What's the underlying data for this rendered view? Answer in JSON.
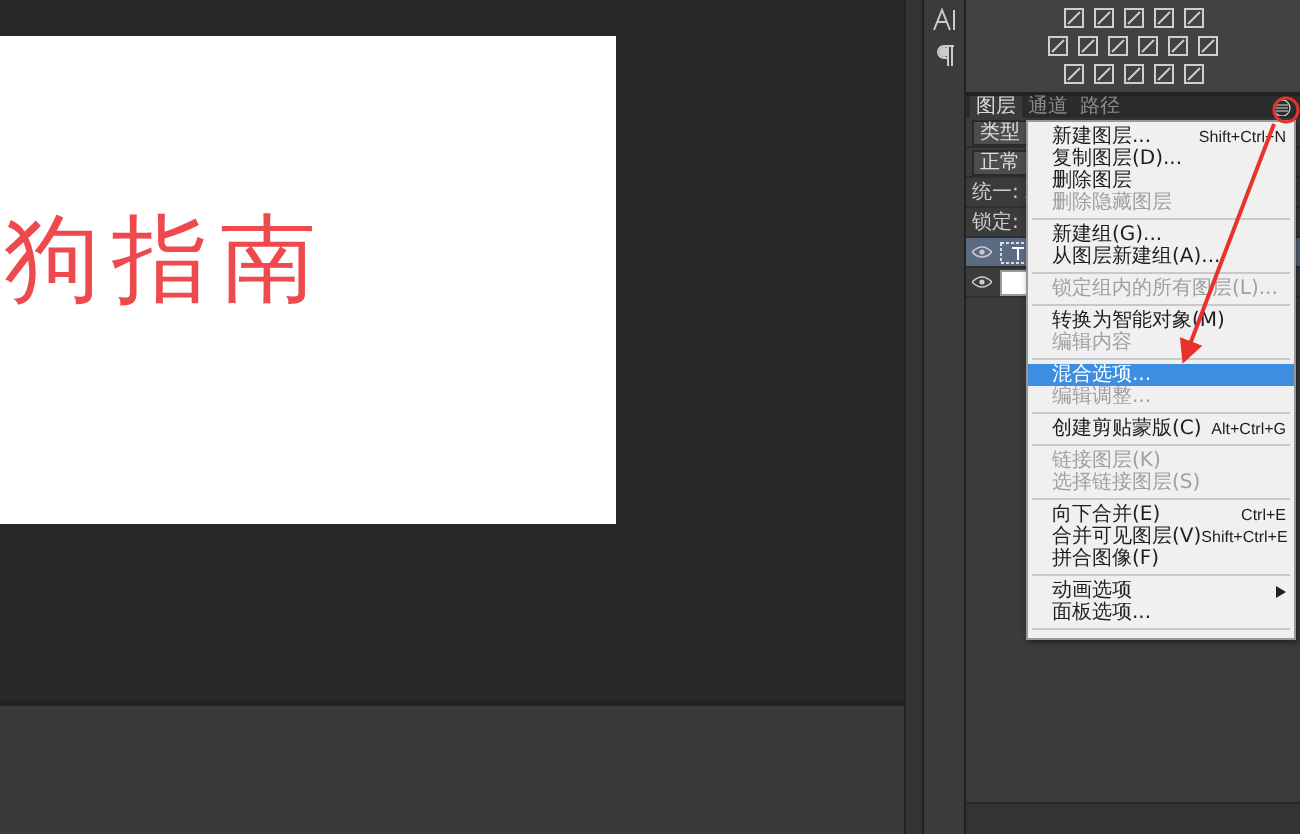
{
  "canvas": {
    "text": "狗指南"
  },
  "layers_panel": {
    "tabs": [
      {
        "label": "图层",
        "selected": true
      },
      {
        "label": "通道",
        "selected": false
      },
      {
        "label": "路径",
        "selected": false
      }
    ],
    "filter": "类型",
    "blend_mode": "正常",
    "unify_label": "统一:",
    "lock_label": "锁定:",
    "layers": [
      {
        "kind": "text",
        "visible": true,
        "selected": true
      },
      {
        "kind": "fill",
        "visible": true,
        "selected": false
      }
    ]
  },
  "context_menu": {
    "items": [
      {
        "kind": "item",
        "label": "新建图层...",
        "shortcut": "Shift+Ctrl+N",
        "disabled": false,
        "selected": false
      },
      {
        "kind": "item",
        "label": "复制图层(D)...",
        "disabled": false,
        "selected": false
      },
      {
        "kind": "item",
        "label": "删除图层",
        "disabled": false,
        "selected": false
      },
      {
        "kind": "item",
        "label": "删除隐藏图层",
        "disabled": true,
        "selected": false
      },
      {
        "kind": "separator"
      },
      {
        "kind": "item",
        "label": "新建组(G)...",
        "disabled": false,
        "selected": false
      },
      {
        "kind": "item",
        "label": "从图层新建组(A)...",
        "disabled": false,
        "selected": false
      },
      {
        "kind": "separator"
      },
      {
        "kind": "item",
        "label": "锁定组内的所有图层(L)...",
        "disabled": true,
        "selected": false
      },
      {
        "kind": "separator"
      },
      {
        "kind": "item",
        "label": "转换为智能对象(M)",
        "disabled": false,
        "selected": false
      },
      {
        "kind": "item",
        "label": "编辑内容",
        "disabled": true,
        "selected": false
      },
      {
        "kind": "separator"
      },
      {
        "kind": "item",
        "label": "混合选项...",
        "disabled": false,
        "selected": true
      },
      {
        "kind": "item",
        "label": "编辑调整...",
        "disabled": true,
        "selected": false
      },
      {
        "kind": "separator"
      },
      {
        "kind": "item",
        "label": "创建剪贴蒙版(C)",
        "shortcut": "Alt+Ctrl+G",
        "disabled": false,
        "selected": false
      },
      {
        "kind": "separator"
      },
      {
        "kind": "item",
        "label": "链接图层(K)",
        "disabled": true,
        "selected": false
      },
      {
        "kind": "item",
        "label": "选择链接图层(S)",
        "disabled": true,
        "selected": false
      },
      {
        "kind": "separator"
      },
      {
        "kind": "item",
        "label": "向下合并(E)",
        "shortcut": "Ctrl+E",
        "disabled": false,
        "selected": false
      },
      {
        "kind": "item",
        "label": "合并可见图层(V)",
        "shortcut": "Shift+Ctrl+E",
        "disabled": false,
        "selected": false
      },
      {
        "kind": "item",
        "label": "拼合图像(F)",
        "disabled": false,
        "selected": false
      },
      {
        "kind": "separator"
      },
      {
        "kind": "submenu",
        "label": "动画选项",
        "disabled": false,
        "selected": false
      },
      {
        "kind": "item",
        "label": "面板选项...",
        "disabled": false,
        "selected": false
      },
      {
        "kind": "separator"
      }
    ]
  }
}
